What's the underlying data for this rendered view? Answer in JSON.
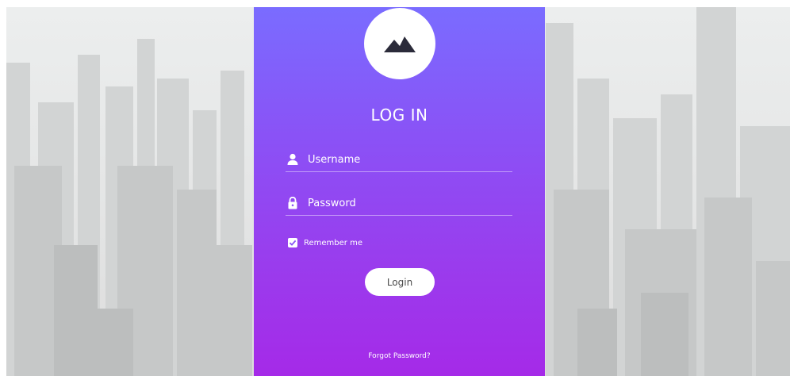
{
  "login": {
    "title": "LOG IN",
    "username_placeholder": "Username",
    "password_placeholder": "Password",
    "remember_label": "Remember me",
    "remember_checked": true,
    "login_button": "Login",
    "forgot_link": "Forgot Password?"
  },
  "icons": {
    "logo": "mountain-icon",
    "username": "user-icon",
    "password": "lock-icon",
    "remember": "checkmark-icon"
  },
  "colors": {
    "card_gradient_top": "#7a6cff",
    "card_gradient_bottom": "#a52ae8",
    "button_bg": "#ffffff",
    "button_text": "#4a4a4a",
    "mountain": "#2b2b3a"
  }
}
